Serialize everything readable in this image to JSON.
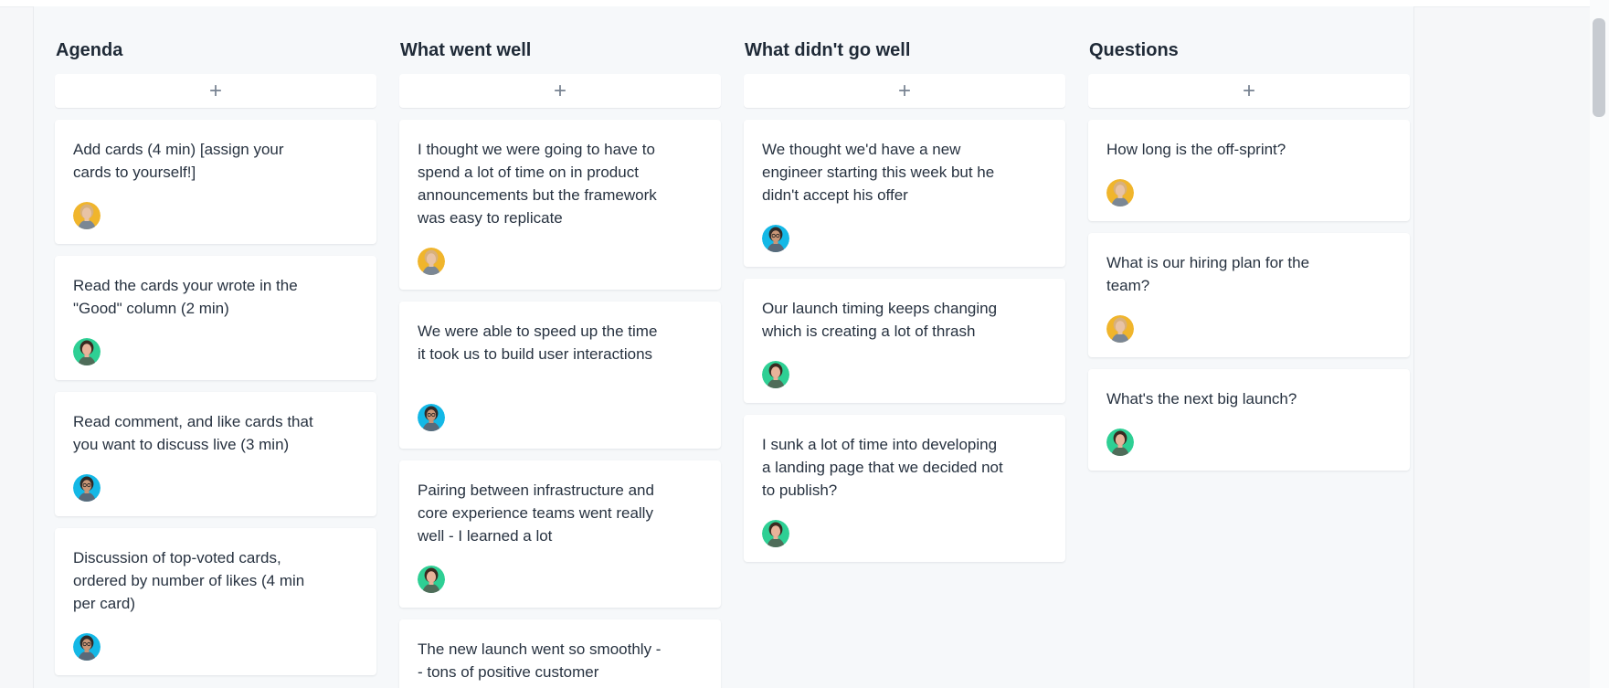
{
  "columns": [
    {
      "title": "Agenda",
      "add_button": "+",
      "cards": [
        {
          "text": "Add cards (4 min) [assign your cards to yourself!]",
          "avatar": "blonde-avatar",
          "avatar_color": "#f0b52c"
        },
        {
          "text": "Read the cards your wrote in the \"Good\" column (2 min)",
          "avatar": "brunette-avatar",
          "avatar_color": "#2ecf94"
        },
        {
          "text": "Read comment, and like cards that you want to discuss live (3 min)",
          "avatar": "glasses-avatar",
          "avatar_color": "#14b8e6"
        },
        {
          "text": "Discussion of top-voted cards, ordered by number of likes (4 min per card)",
          "avatar": "glasses-avatar",
          "avatar_color": "#14b8e6"
        }
      ]
    },
    {
      "title": "What went well",
      "add_button": "+",
      "cards": [
        {
          "text": "I thought we were going to have to spend a lot of time on in product announcements but the framework was easy to replicate",
          "avatar": "blonde-avatar",
          "avatar_color": "#f0b52c"
        },
        {
          "text": "We were able to speed up the time it took us to build user interactions",
          "avatar": "glasses-avatar",
          "avatar_color": "#14b8e6"
        },
        {
          "text": "Pairing between infrastructure and core experience teams went really well - I learned a lot",
          "avatar": "brunette-avatar",
          "avatar_color": "#2ecf94"
        },
        {
          "text": "The new launch went so smoothly -- tons of positive customer",
          "avatar": "glasses-avatar",
          "avatar_color": "#14b8e6"
        }
      ]
    },
    {
      "title": "What didn't go well",
      "add_button": "+",
      "cards": [
        {
          "text": "We thought we'd have a new engineer starting this week but he didn't accept his offer",
          "avatar": "brunette-avatar",
          "avatar_color": "#2ecf94"
        },
        {
          "text": "Our launch timing keeps changing which is creating a lot of thrash",
          "avatar": "brunette-avatar",
          "avatar_color": "#2ecf94"
        },
        {
          "text": "I sunk a lot of time into developing a landing page that we decided not to publish?",
          "avatar": "blonde-avatar",
          "avatar_color": "#f0b52c"
        }
      ]
    },
    {
      "title": "Questions",
      "add_button": "+",
      "cards": [
        {
          "text": "How long is the off-sprint?",
          "avatar": "blonde-avatar",
          "avatar_color": "#f0b52c"
        },
        {
          "text": "What is our hiring plan for the team?",
          "avatar": "brunette-avatar",
          "avatar_color": "#2ecf94"
        },
        {
          "text": "What's the next big launch?",
          "avatar": "glasses-avatar",
          "avatar_color": "#14b8e6"
        }
      ]
    }
  ]
}
